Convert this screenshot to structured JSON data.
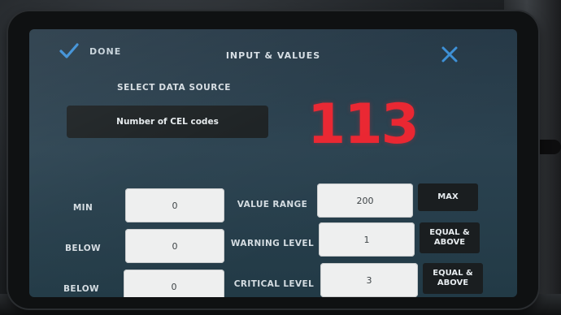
{
  "header": {
    "done_label": "DONE",
    "title": "INPUT & VALUES",
    "done_icon": "checkmark-icon",
    "close_icon": "close-icon"
  },
  "data_source": {
    "label": "SELECT DATA SOURCE",
    "selected": "Number of CEL codes"
  },
  "live_value": "113",
  "colors": {
    "accent": "#3b8fd6",
    "value_red": "#ea2530",
    "screen_bg": "#2b4250"
  },
  "rows": [
    {
      "left_label": "MIN",
      "left_value": "0",
      "center_label": "VALUE RANGE",
      "right_value": "200",
      "right_label": "MAX"
    },
    {
      "left_label": "BELOW",
      "left_value": "0",
      "center_label": "WARNING LEVEL",
      "right_value": "1",
      "right_label": "EQUAL & ABOVE"
    },
    {
      "left_label": "BELOW",
      "left_value": "0",
      "center_label": "CRITICAL LEVEL",
      "right_value": "3",
      "right_label": "EQUAL & ABOVE"
    }
  ]
}
